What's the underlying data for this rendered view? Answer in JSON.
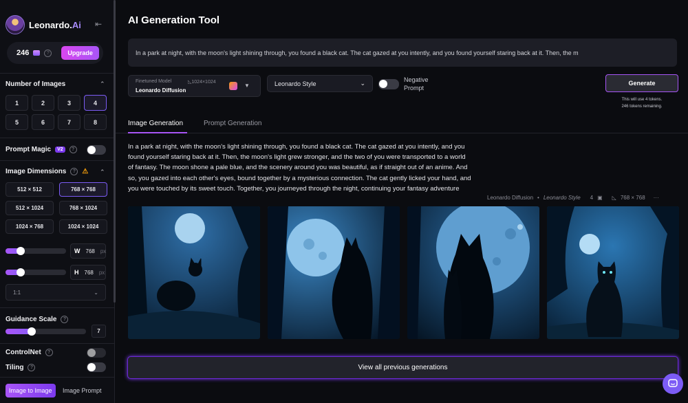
{
  "brand": {
    "name": "Leonardo.",
    "name_suffix": "Ai"
  },
  "tokens": {
    "count": "246",
    "upgrade_label": "Upgrade"
  },
  "sidebar": {
    "num_images": {
      "label": "Number of Images",
      "options": [
        "1",
        "2",
        "3",
        "4",
        "5",
        "6",
        "7",
        "8"
      ],
      "selected": "4"
    },
    "prompt_magic": {
      "label": "Prompt Magic",
      "badge": "V2",
      "enabled": false
    },
    "dimensions": {
      "label": "Image Dimensions",
      "options": [
        "512 × 512",
        "768 × 768",
        "512 × 1024",
        "768 × 1024",
        "1024 × 768",
        "1024 × 1024"
      ],
      "selected": "768 × 768"
    },
    "width": {
      "label": "W",
      "value": "768",
      "unit": "px",
      "fraction": 0.2
    },
    "height": {
      "label": "H",
      "value": "768",
      "unit": "px",
      "fraction": 0.2
    },
    "aspect_ratio": "1:1",
    "guidance": {
      "label": "Guidance Scale",
      "value": "7",
      "fraction": 0.32
    },
    "controlnet": {
      "label": "ControlNet",
      "enabled": false
    },
    "tiling": {
      "label": "Tiling",
      "enabled": false
    },
    "tabs": {
      "image_to_image": "Image to Image",
      "image_prompt": "Image Prompt"
    }
  },
  "main": {
    "title": "AI Generation Tool",
    "prompt": "In a park at night, with the moon's light shining through, you found a black cat. The cat gazed at you intently, and you found yourself staring back at it. Then, the m",
    "model": {
      "label": "Finetuned Model",
      "resolution": "1024×1024",
      "name": "Leonardo Diffusion"
    },
    "style": "Leonardo Style",
    "negative_prompt_label": "Negative Prompt",
    "generate_label": "Generate",
    "generate_note_1": "This will use 4 tokens.",
    "generate_note_2": "246 tokens remaining.",
    "tabs": [
      "Image Generation",
      "Prompt Generation"
    ],
    "story": "In a park at night, with the moon's light shining through, you found a black cat. The cat gazed at you intently, and you found yourself staring back at it. Then, the moon's light grew stronger, and the two of you were transported to a world of fantasy. The moon shone a pale blue, and the scenery around you was beautiful, as if straight out of an anime. And so, you gazed into each other's eyes, bound together by a mysterious connection. The cat gently licked your hand, and you were touched by its sweet touch. Together, you journeyed through the night, continuing your fantasy adventure",
    "meta": {
      "model": "Leonardo Diffusion",
      "style": "Leonardo Style",
      "count": "4",
      "size": "768 × 768"
    },
    "view_all_label": "View all previous generations"
  },
  "colors": {
    "accent": "#a855f7",
    "background": "#0b0c10",
    "panel": "#1a1b23"
  }
}
